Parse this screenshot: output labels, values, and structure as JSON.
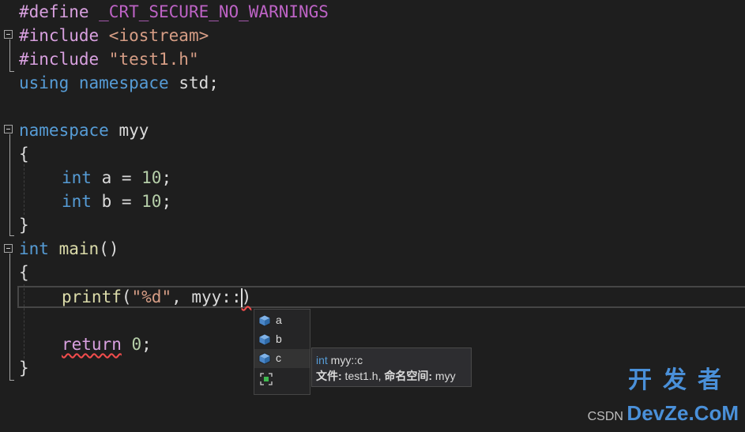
{
  "editor": {
    "lines": {
      "l1": {
        "a": "#define",
        "b": " _CRT_SECURE_NO_WARNINGS"
      },
      "l2": {
        "a": "#include",
        "b": " <iostream>"
      },
      "l3": {
        "a": "#include",
        "b": " \"test1.h\""
      },
      "l4": {
        "a": "using",
        "b": " ",
        "c": "namespace",
        "d": " std;"
      },
      "l6": {
        "a": "namespace",
        "b": " myy"
      },
      "l7": {
        "a": "{"
      },
      "l8": {
        "a": "int",
        "b": " a = ",
        "c": "10",
        "d": ";"
      },
      "l9": {
        "a": "int",
        "b": " b = ",
        "c": "10",
        "d": ";"
      },
      "l10": {
        "a": "}"
      },
      "l11": {
        "a": "int",
        "b": " ",
        "c": "main",
        "d": "()"
      },
      "l12": {
        "a": "{"
      },
      "l13": {
        "a": "printf",
        "b": "(",
        "c": "\"%d\"",
        "d": ", myy::",
        "e": ")"
      },
      "l15": {
        "a": "return",
        "b": " ",
        "c": "0",
        "d": ";"
      },
      "l16": {
        "a": "}"
      }
    }
  },
  "completion": {
    "items": [
      {
        "label": "a"
      },
      {
        "label": "b"
      },
      {
        "label": "c"
      }
    ],
    "icon": "member-cube-icon"
  },
  "tooltip": {
    "type": "int",
    "name": " myy::c",
    "file_label": "文件:",
    "file_value": " test1.h, ",
    "ns_label": "命名空间:",
    "ns_value": " myy"
  },
  "watermark": {
    "top": "开发者",
    "csdn": "CSDN",
    "brand": "DevZe.CoM"
  },
  "colors": {
    "background": "#1e1e1e",
    "keyword": "#569cd6",
    "string": "#d69d85",
    "number": "#b5cea8",
    "function": "#dcdcaa",
    "control": "#d8a0df",
    "error_squiggle": "#f14c4c"
  }
}
